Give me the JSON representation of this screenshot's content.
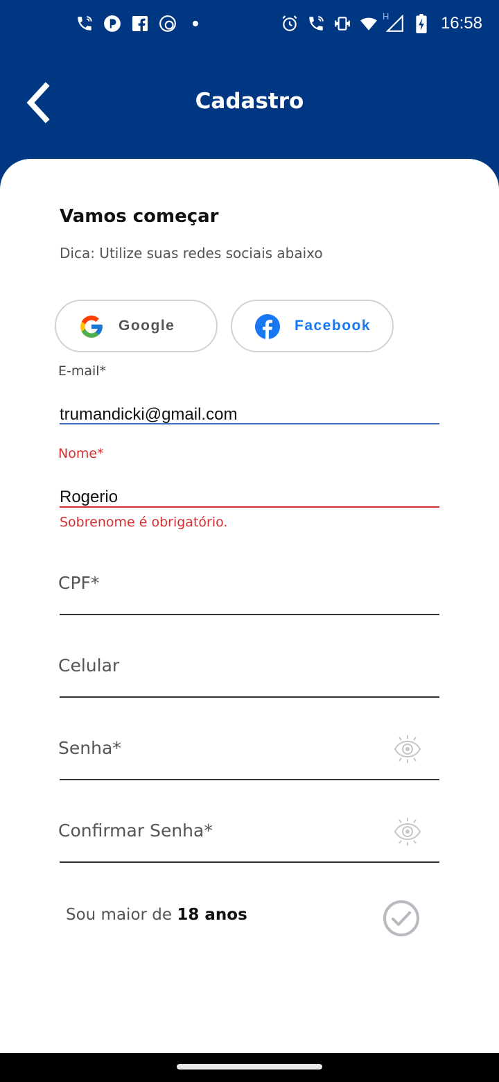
{
  "status_bar": {
    "time": "16:58",
    "left_icons": [
      "phone-wifi-icon",
      "app-p-icon",
      "facebook-icon",
      "chat-icon",
      "dot-icon"
    ],
    "right_icons": [
      "alarm-icon",
      "phone-wifi-icon",
      "vibrate-icon",
      "wifi-icon",
      "signal-h-icon",
      "battery-charging-icon"
    ],
    "network_label": "H"
  },
  "header": {
    "title": "Cadastro",
    "back_icon": "chevron-left-icon",
    "background": "#003783"
  },
  "intro": {
    "title": "Vamos começar",
    "hint": "Dica: Utilize suas redes sociais abaixo"
  },
  "social": {
    "google_label": "Google",
    "facebook_label": "Facebook"
  },
  "form": {
    "email": {
      "label": "E-mail*",
      "value": "trumandicki@gmail.com"
    },
    "name": {
      "label": "Nome*",
      "value": "Rogerio",
      "error": "Sobrenome é obrigatório."
    },
    "cpf": {
      "placeholder": "CPF*"
    },
    "phone": {
      "placeholder": "Celular"
    },
    "password": {
      "placeholder": "Senha*"
    },
    "confirm_password": {
      "placeholder": "Confirmar Senha*"
    }
  },
  "age": {
    "prefix": "Sou maior de ",
    "emphasis": "18 anos"
  },
  "colors": {
    "brand_blue": "#003783",
    "error_red": "#d32f2f",
    "focus_blue": "#3b73c9",
    "facebook_blue": "#1877f2"
  }
}
